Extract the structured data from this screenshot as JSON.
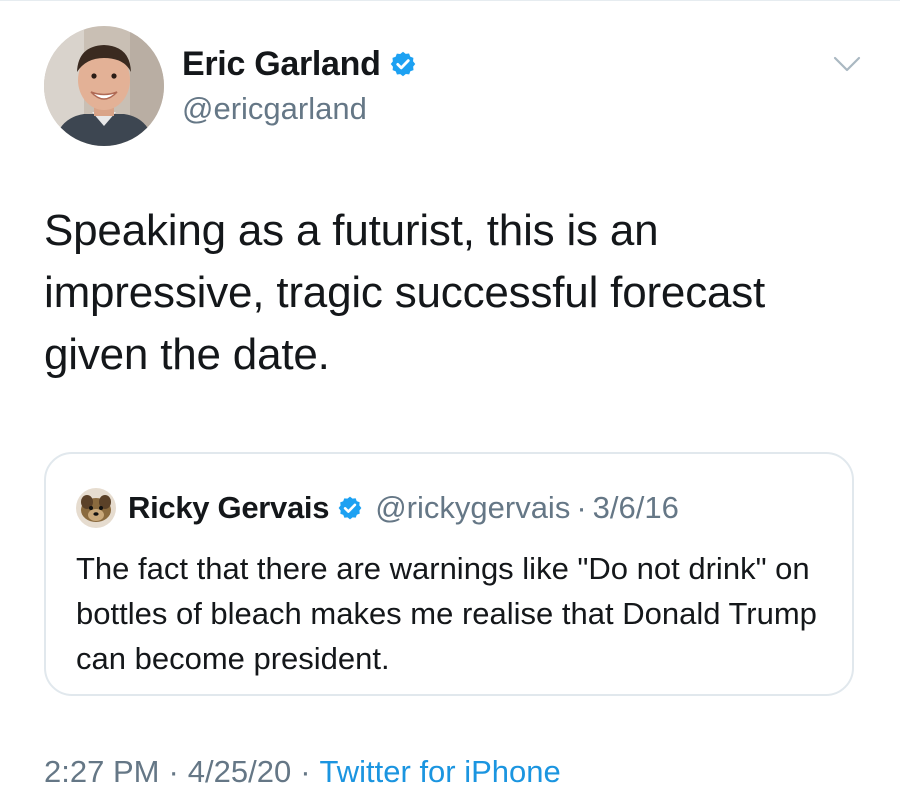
{
  "tweet": {
    "author": {
      "display_name": "Eric Garland",
      "handle": "@ericgarland",
      "verified": true,
      "avatar_icon": "author-avatar"
    },
    "text": "Speaking as a futurist, this is an impressive, tragic successful forecast given the date.",
    "menu_icon": "chevron-down-icon",
    "quoted_tweet": {
      "author": {
        "display_name": "Ricky Gervais",
        "handle": "@rickygervais",
        "verified": true,
        "avatar_icon": "quoted-author-avatar"
      },
      "separator": "·",
      "date": "3/6/16",
      "text": "The fact that there are warnings like \"Do not drink\" on bottles of bleach makes me realise that Donald Trump can become president."
    },
    "meta": {
      "time": "2:27 PM",
      "separator": "·",
      "date": "4/25/20",
      "source": "Twitter for iPhone"
    }
  },
  "colors": {
    "verified_badge": "#1da1f2",
    "link": "#1b95e0",
    "secondary_text": "#657786",
    "border": "#e1e8ed"
  }
}
